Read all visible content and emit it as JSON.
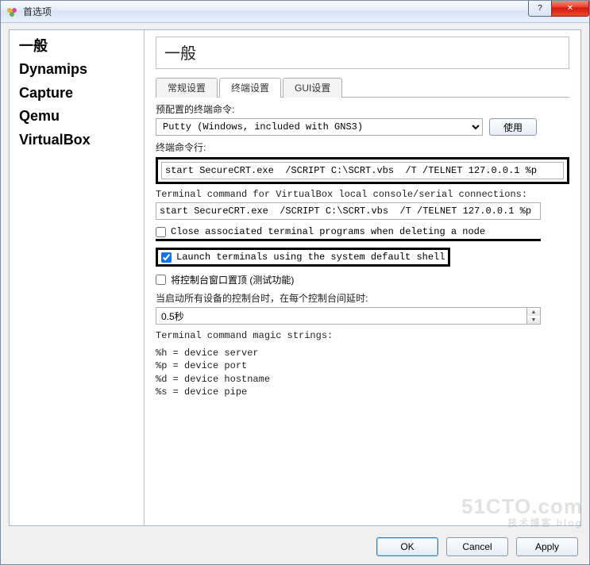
{
  "window": {
    "title": "首选项",
    "help_label": "?",
    "close_label": "✕"
  },
  "sidebar": {
    "items": [
      {
        "label": "一般"
      },
      {
        "label": "Dynamips"
      },
      {
        "label": "Capture"
      },
      {
        "label": "Qemu"
      },
      {
        "label": "VirtualBox"
      }
    ]
  },
  "main": {
    "section_title": "一般",
    "tabs": [
      {
        "label": "常规设置"
      },
      {
        "label": "终端设置"
      },
      {
        "label": "GUI设置"
      }
    ],
    "active_tab": 1,
    "preconfig_label": "预配置的终端命令:",
    "preconfig_value": "Putty (Windows, included with GNS3)",
    "use_button": "使用",
    "cmdline_label": "终端命令行:",
    "cmdline_value": "start SecureCRT.exe  /SCRIPT C:\\SCRT.vbs  /T /TELNET 127.0.0.1 %p",
    "vbox_label": "Terminal command for VirtualBox local console/serial connections:",
    "vbox_value": "start SecureCRT.exe  /SCRIPT C:\\SCRT.vbs  /T /TELNET 127.0.0.1 %p",
    "chk_close_label": "Close associated terminal programs when deleting a node",
    "chk_close_checked": false,
    "chk_launch_label": "Launch terminals using the system default shell",
    "chk_launch_checked": true,
    "chk_top_label": "将控制台窗口置顶 (测试功能)",
    "chk_top_checked": false,
    "delay_label": "当启动所有设备的控制台时，在每个控制台间延时:",
    "delay_value": "0.5秒",
    "magic_heading": "Terminal command magic strings:",
    "magic_lines": "%h = device server\n%p = device port\n%d = device hostname\n%s = device pipe"
  },
  "footer": {
    "ok": "OK",
    "cancel": "Cancel",
    "apply": "Apply"
  },
  "watermark": {
    "main": "51CTO.com",
    "sub": "技术博客  blog"
  }
}
